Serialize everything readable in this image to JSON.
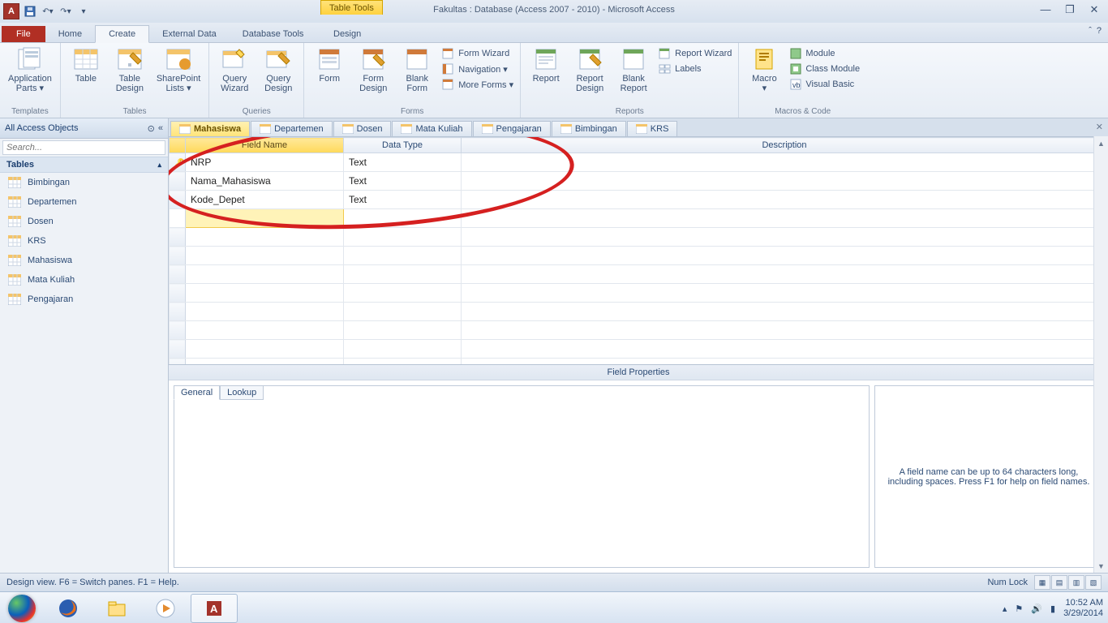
{
  "titlebar": {
    "title": "Fakultas : Database (Access 2007 - 2010)  -  Microsoft Access",
    "table_tools": "Table Tools"
  },
  "tabs": {
    "file": "File",
    "home": "Home",
    "create": "Create",
    "external": "External Data",
    "dbtools": "Database Tools",
    "design": "Design"
  },
  "ribbon": {
    "templates": {
      "label": "Templates",
      "app_parts": "Application\nParts ▾"
    },
    "tables": {
      "label": "Tables",
      "table": "Table",
      "table_design": "Table\nDesign",
      "sp_lists": "SharePoint\nLists ▾"
    },
    "queries": {
      "label": "Queries",
      "qwizard": "Query\nWizard",
      "qdesign": "Query\nDesign"
    },
    "forms": {
      "label": "Forms",
      "form": "Form",
      "form_design": "Form\nDesign",
      "blank_form": "Blank\nForm",
      "form_wizard": "Form Wizard",
      "navigation": "Navigation ▾",
      "more_forms": "More Forms ▾"
    },
    "reports": {
      "label": "Reports",
      "report": "Report",
      "report_design": "Report\nDesign",
      "blank_report": "Blank\nReport",
      "report_wizard": "Report Wizard",
      "labels": "Labels"
    },
    "macros": {
      "label": "Macros & Code",
      "macro": "Macro\n▾",
      "module": "Module",
      "class_module": "Class Module",
      "vb": "Visual Basic"
    }
  },
  "nav": {
    "header": "All Access Objects",
    "search_placeholder": "Search...",
    "group": "Tables",
    "items": [
      "Bimbingan",
      "Departemen",
      "Dosen",
      "KRS",
      "Mahasiswa",
      "Mata Kuliah",
      "Pengajaran"
    ]
  },
  "doctabs": [
    "Mahasiswa",
    "Departemen",
    "Dosen",
    "Mata Kuliah",
    "Pengajaran",
    "Bimbingan",
    "KRS"
  ],
  "design": {
    "cols": {
      "field_name": "Field Name",
      "data_type": "Data Type",
      "description": "Description"
    },
    "rows": [
      {
        "pk": true,
        "name": "NRP",
        "type": "Text"
      },
      {
        "pk": false,
        "name": "Nama_Mahasiswa",
        "type": "Text"
      },
      {
        "pk": false,
        "name": "Kode_Depet",
        "type": "Text"
      }
    ]
  },
  "fp": {
    "title": "Field Properties",
    "general": "General",
    "lookup": "Lookup",
    "hint": "A field name can be up to 64 characters long, including spaces. Press F1 for help on field names."
  },
  "status": {
    "left": "Design view.  F6 = Switch panes.  F1 = Help.",
    "numlock": "Num Lock"
  },
  "tray": {
    "time": "10:52 AM",
    "date": "3/29/2014"
  }
}
